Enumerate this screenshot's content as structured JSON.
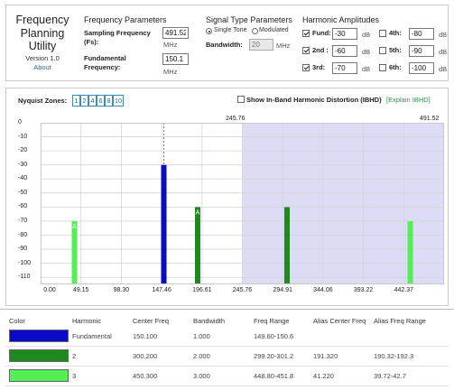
{
  "app": {
    "title_line1": "Frequency",
    "title_line2": "Planning",
    "title_line3": "Utility",
    "version": "Version 1.0",
    "about_link": "About"
  },
  "freq_params": {
    "heading": "Frequency Parameters",
    "sampling_label": "Sampling Frequency",
    "sampling_sub": "(Fs):",
    "sampling_value": "491.52",
    "sampling_unit": "MHz",
    "fundamental_label": "Fundamental",
    "fundamental_label2": "Frequency:",
    "fundamental_value": "150.1",
    "fundamental_unit": "MHz"
  },
  "signal_type": {
    "heading": "Signal Type Parameters",
    "single_tone": "Single Tone",
    "modulated": "Modulated",
    "bandwidth_label": "Bandwidth:",
    "bandwidth_value": "20",
    "bandwidth_unit": "MHz"
  },
  "harmonics": {
    "heading": "Harmonic Amplitudes",
    "items": [
      {
        "label": "Fund:",
        "value": "-30",
        "unit": "dB",
        "checked": true
      },
      {
        "label": "2nd :",
        "value": "-60",
        "unit": "dB",
        "checked": true
      },
      {
        "label": "3rd:",
        "value": "-70",
        "unit": "dB",
        "checked": true
      },
      {
        "label": "4th:",
        "value": "-80",
        "unit": "dB",
        "checked": false
      },
      {
        "label": "5th:",
        "value": "-90",
        "unit": "dB",
        "checked": false
      },
      {
        "label": "6th:",
        "value": "-100",
        "unit": "dB",
        "checked": false
      }
    ]
  },
  "chart_controls": {
    "nyquist_label": "Nyquist Zones:",
    "zones": [
      "1",
      "2",
      "4",
      "6",
      "8",
      "10"
    ],
    "ibhd_label": "Show In-Band Harmonic Distortion (IBHD)",
    "explain_link": "[Explain IBHD]",
    "marker_mid": "245.76",
    "marker_end": "491.52"
  },
  "chart_data": {
    "type": "bar",
    "title": "",
    "xlabel": "",
    "ylabel": "",
    "xlim": [
      0,
      491.52
    ],
    "ylim": [
      -115,
      0
    ],
    "x_ticks": [
      "0.00",
      "49.15",
      "98.30",
      "147.46",
      "196.61",
      "245.76",
      "294.91",
      "344.06",
      "393.22",
      "442.37"
    ],
    "y_ticks": [
      "0",
      "-10",
      "-20",
      "-30",
      "-40",
      "-50",
      "-60",
      "-70",
      "-80",
      "-90",
      "-100",
      "-110"
    ],
    "shaded_range": [
      245.76,
      491.52
    ],
    "dashed_marker_x": 150.1,
    "series": [
      {
        "name": "Fundamental",
        "color": "#0a0ac8",
        "bars": [
          {
            "x": 150.1,
            "y": -30
          }
        ]
      },
      {
        "name": "2",
        "color": "#1e8a1e",
        "bars": [
          {
            "x": 191.32,
            "y": -60,
            "label": "A"
          },
          {
            "x": 300.2,
            "y": -60
          }
        ]
      },
      {
        "name": "3",
        "color": "#55ee55",
        "bars": [
          {
            "x": 41.22,
            "y": -70,
            "label": "A"
          },
          {
            "x": 450.3,
            "y": -70
          }
        ]
      }
    ]
  },
  "table": {
    "headers": [
      "Color",
      "Harmonic",
      "Center Freq",
      "Bandwidth",
      "Freq Range",
      "Alias Center Freq",
      "Alias Freq Range"
    ],
    "rows": [
      {
        "color": "#0a0ac8",
        "harmonic": "Fundamental",
        "center": "150.100",
        "bw": "1.000",
        "range": "149.60-150.6",
        "alias_center": "",
        "alias_range": ""
      },
      {
        "color": "#1e8a1e",
        "harmonic": "2",
        "center": "300.200",
        "bw": "2.000",
        "range": "299.20-301.2",
        "alias_center": "191.320",
        "alias_range": "190.32-192.3"
      },
      {
        "color": "#55ee55",
        "harmonic": "3",
        "center": "450.300",
        "bw": "3.000",
        "range": "448.80-451.8",
        "alias_center": "41.220",
        "alias_range": "39.72-42.7"
      }
    ]
  }
}
